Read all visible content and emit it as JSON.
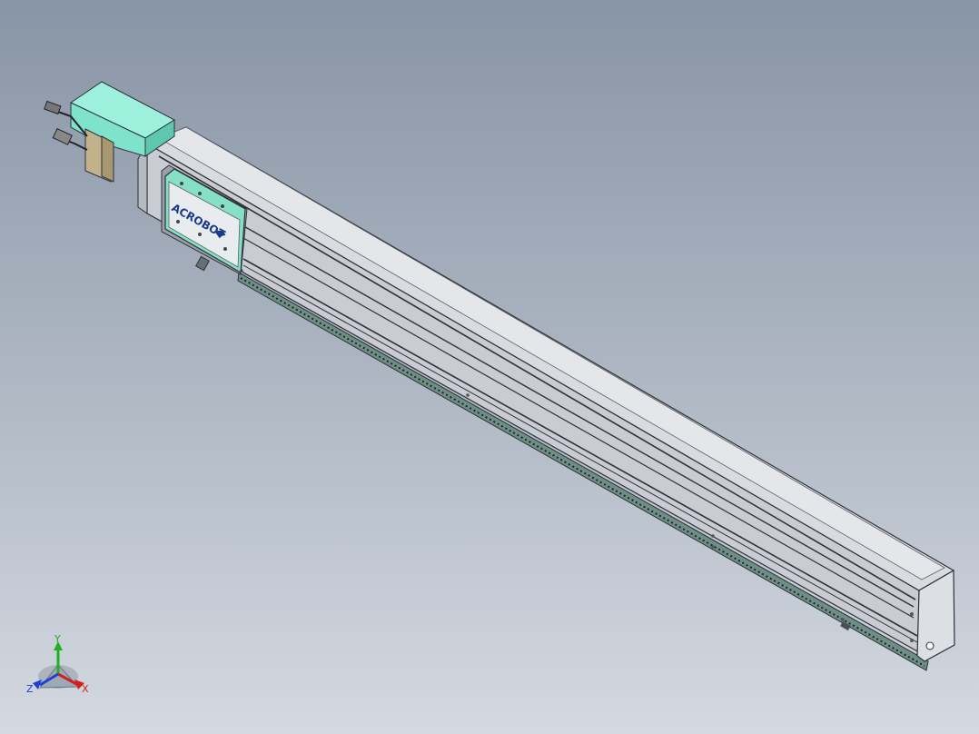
{
  "viewport": {
    "background_top": "#8895a6",
    "background_bottom": "#d4d9e0"
  },
  "model": {
    "carriage_logo_text": "ACROBOT",
    "colors": {
      "motor_housing": "#7fe3cc",
      "carriage_plate": "#86e0c6",
      "rail_body": "#c9ccd3",
      "rail_edge": "#2e3138",
      "motor_body": "#c2b28c"
    }
  },
  "triad": {
    "x_label": "X",
    "y_label": "Y",
    "z_label": "Z",
    "x_color": "#d22020",
    "y_color": "#20b020",
    "z_color": "#2040d0"
  }
}
